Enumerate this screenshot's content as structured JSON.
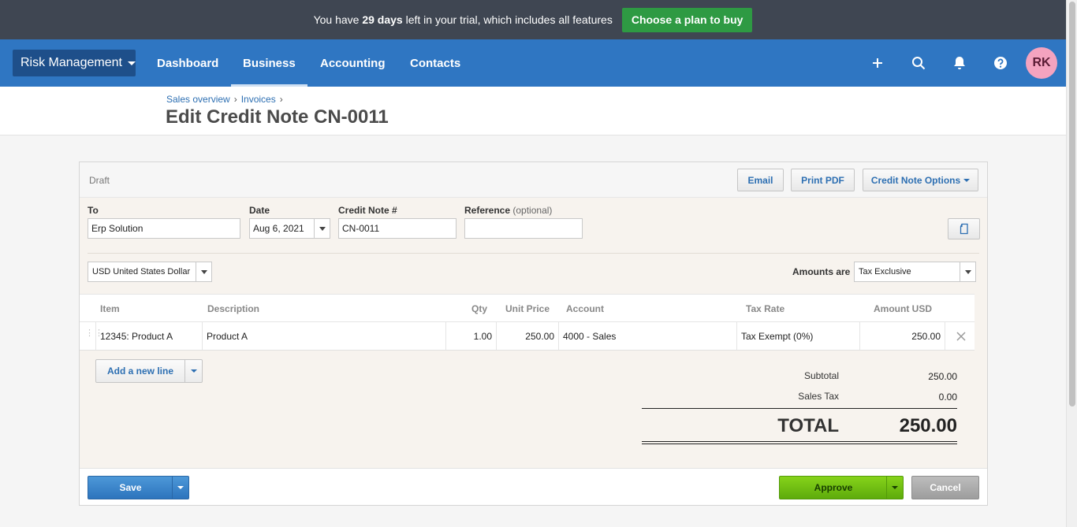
{
  "trial_bar": {
    "text_before": "You have ",
    "days": "29 days",
    "text_after": " left in your trial, which includes all features",
    "plan_button": "Choose a plan to buy"
  },
  "nav": {
    "org_name": "Risk Management",
    "links": [
      {
        "label": "Dashboard",
        "active": false
      },
      {
        "label": "Business",
        "active": true
      },
      {
        "label": "Accounting",
        "active": false
      },
      {
        "label": "Contacts",
        "active": false
      }
    ],
    "icons": [
      "plus-icon",
      "search-icon",
      "bell-icon",
      "help-icon"
    ],
    "avatar_initials": "RK"
  },
  "breadcrumb": [
    "Sales overview",
    "Invoices"
  ],
  "page_title": "Edit Credit Note CN-0011",
  "document": {
    "status": "Draft",
    "buttons": {
      "email": "Email",
      "print_pdf": "Print PDF",
      "options": "Credit Note Options"
    },
    "fields": {
      "to_label": "To",
      "to_value": "Erp Solution",
      "date_label": "Date",
      "date_value": "Aug 6, 2021",
      "number_label": "Credit Note #",
      "number_value": "CN-0011",
      "reference_label": "Reference",
      "reference_optional": "(optional)",
      "reference_value": ""
    },
    "currency": "USD United States Dollar",
    "amounts_are_label": "Amounts are",
    "amounts_are_value": "Tax Exclusive"
  },
  "line_items": {
    "columns": [
      "Item",
      "Description",
      "Qty",
      "Unit Price",
      "Account",
      "Tax Rate",
      "Amount USD"
    ],
    "rows": [
      {
        "item": "12345: Product A",
        "description": "Product A",
        "qty": "1.00",
        "unit_price": "250.00",
        "account": "4000 - Sales",
        "tax_rate": "Tax Exempt (0%)",
        "amount": "250.00"
      }
    ],
    "add_line": "Add a new line"
  },
  "totals": {
    "subtotal_label": "Subtotal",
    "subtotal_value": "250.00",
    "tax_label": "Sales Tax",
    "tax_value": "0.00",
    "total_label": "TOTAL",
    "total_value": "250.00"
  },
  "footer": {
    "save": "Save",
    "approve": "Approve",
    "cancel": "Cancel"
  },
  "colors": {
    "nav_blue": "#2f76c2",
    "trial_bg": "#3f4652",
    "plan_green": "#2e9a43",
    "approve_green": "#6cbf12",
    "save_blue": "#2d74bd",
    "avatar_pink": "#f4a3bf"
  }
}
